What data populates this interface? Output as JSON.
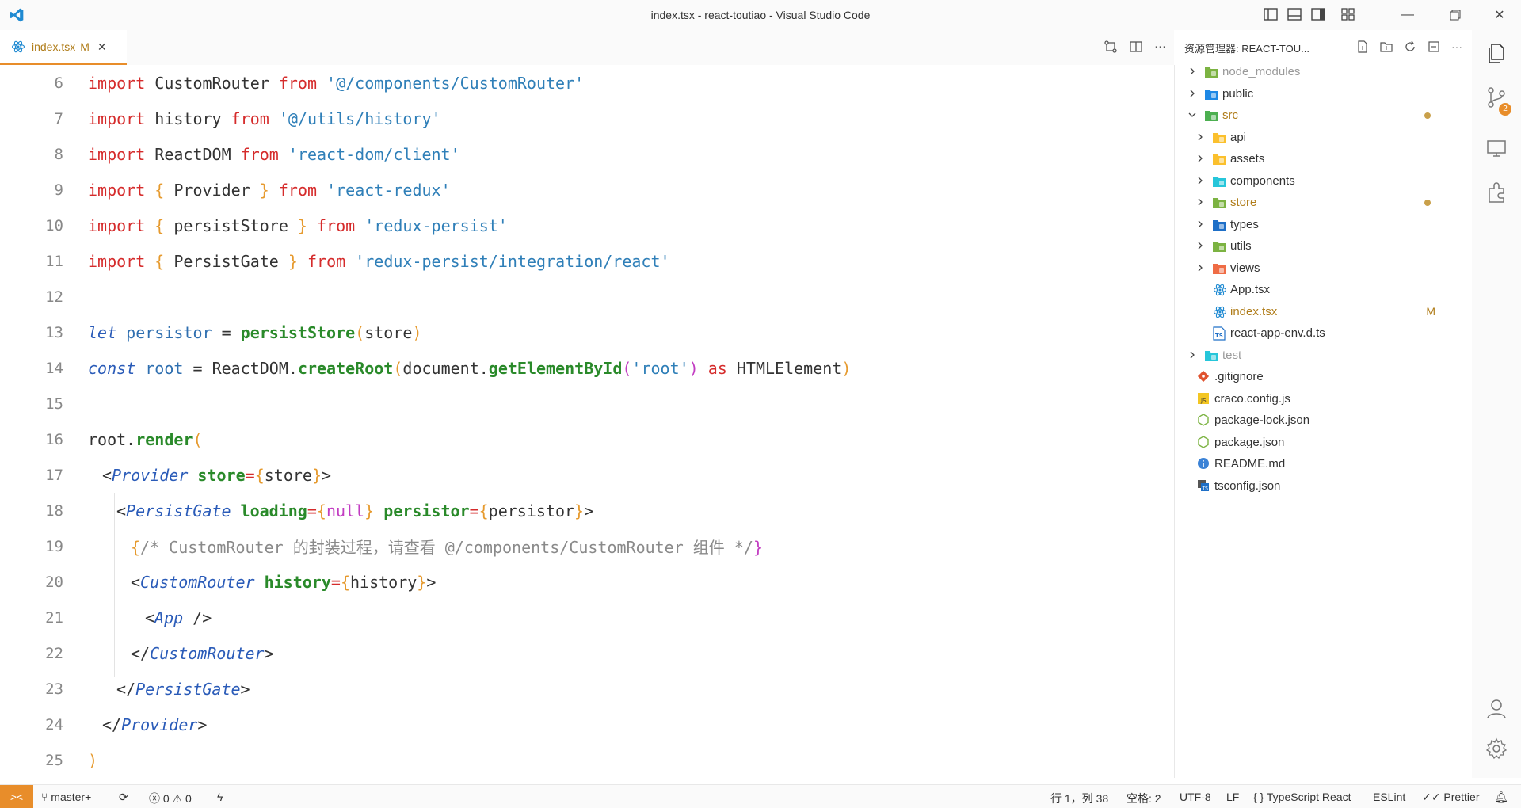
{
  "window": {
    "title": "index.tsx - react-toutiao - Visual Studio Code"
  },
  "tab": {
    "filename": "index.tsx",
    "status": "M"
  },
  "editor": {
    "lines": [
      {
        "n": "6"
      },
      {
        "n": "7"
      },
      {
        "n": "8"
      },
      {
        "n": "9"
      },
      {
        "n": "10"
      },
      {
        "n": "11"
      },
      {
        "n": "12"
      },
      {
        "n": "13"
      },
      {
        "n": "14"
      },
      {
        "n": "15"
      },
      {
        "n": "16"
      },
      {
        "n": "17"
      },
      {
        "n": "18"
      },
      {
        "n": "19"
      },
      {
        "n": "20"
      },
      {
        "n": "21"
      },
      {
        "n": "22"
      },
      {
        "n": "23"
      },
      {
        "n": "24"
      },
      {
        "n": "25"
      }
    ],
    "code": {
      "l6": [
        "import",
        " CustomRouter ",
        "from",
        " ",
        "'@/components/CustomRouter'"
      ],
      "l7": [
        "import",
        " history ",
        "from",
        " ",
        "'@/utils/history'"
      ],
      "l8": [
        "import",
        " ReactDOM ",
        "from",
        " ",
        "'react-dom/client'"
      ],
      "l9": [
        "import",
        " ",
        "{",
        " Provider ",
        "}",
        " ",
        "from",
        " ",
        "'react-redux'"
      ],
      "l10": [
        "import",
        " ",
        "{",
        " persistStore ",
        "}",
        " ",
        "from",
        " ",
        "'redux-persist'"
      ],
      "l11": [
        "import",
        " ",
        "{",
        " PersistGate ",
        "}",
        " ",
        "from",
        " ",
        "'redux-persist/integration/react'"
      ],
      "l13": [
        "let",
        " ",
        "persistor",
        " = ",
        "persistStore",
        "(",
        "store",
        ")"
      ],
      "l14": [
        "const",
        " ",
        "root",
        " = ",
        "ReactDOM",
        ".",
        "createRoot",
        "(",
        "document",
        ".",
        "getElementById",
        "(",
        "'root'",
        ")",
        " ",
        "as",
        " HTMLElement",
        ")"
      ],
      "l16": [
        "root",
        ".",
        "render",
        "("
      ],
      "l17": [
        "<",
        "Provider",
        " ",
        "store",
        "=",
        "{",
        "store",
        "}",
        ">"
      ],
      "l18": [
        "<",
        "PersistGate",
        " ",
        "loading",
        "=",
        "{",
        "null",
        "}",
        " ",
        "persistor",
        "=",
        "{",
        "persistor",
        "}",
        ">"
      ],
      "l19": [
        "{",
        "/* CustomRouter 的封装过程，请查看 @/components/CustomRouter 组件 */",
        "}"
      ],
      "l20": [
        "<",
        "CustomRouter",
        " ",
        "history",
        "=",
        "{",
        "history",
        "}",
        ">"
      ],
      "l21": [
        "<",
        "App",
        " />"
      ],
      "l22": [
        "</",
        "CustomRouter",
        ">"
      ],
      "l23": [
        "</",
        "PersistGate",
        ">"
      ],
      "l24": [
        "</",
        "Provider",
        ">"
      ],
      "l25": [
        ")"
      ]
    }
  },
  "explorer": {
    "title": "资源管理器: REACT-TOU...",
    "items": [
      {
        "label": "node_modules",
        "kind": "folder",
        "color": "#7cb342",
        "depth": 0,
        "collapsed": true,
        "dim": true
      },
      {
        "label": "public",
        "kind": "folder",
        "color": "#1e88e5",
        "depth": 0,
        "collapsed": true
      },
      {
        "label": "src",
        "kind": "folder",
        "color": "#4caf50",
        "depth": 0,
        "collapsed": false,
        "dot": true,
        "modified": true
      },
      {
        "label": "api",
        "kind": "folder",
        "color": "#fbc02d",
        "depth": 1,
        "collapsed": true
      },
      {
        "label": "assets",
        "kind": "folder",
        "color": "#fbc02d",
        "depth": 1,
        "collapsed": true
      },
      {
        "label": "components",
        "kind": "folder",
        "color": "#26c6da",
        "depth": 1,
        "collapsed": true
      },
      {
        "label": "store",
        "kind": "folder",
        "color": "#7cb342",
        "depth": 1,
        "collapsed": true,
        "dot": true,
        "modified": true
      },
      {
        "label": "types",
        "kind": "folder",
        "color": "#1e6fc7",
        "depth": 1,
        "collapsed": true
      },
      {
        "label": "utils",
        "kind": "folder",
        "color": "#7cb342",
        "depth": 1,
        "collapsed": true
      },
      {
        "label": "views",
        "kind": "folder",
        "color": "#ef6c45",
        "depth": 1,
        "collapsed": true
      },
      {
        "label": "App.tsx",
        "kind": "react",
        "depth": 1
      },
      {
        "label": "index.tsx",
        "kind": "react",
        "depth": 1,
        "badge": "M",
        "modified": true
      },
      {
        "label": "react-app-env.d.ts",
        "kind": "ts",
        "depth": 1
      },
      {
        "label": "test",
        "kind": "folder",
        "color": "#26c6da",
        "depth": 0,
        "collapsed": true,
        "dim": true
      },
      {
        "label": ".gitignore",
        "kind": "git",
        "depth": 0
      },
      {
        "label": "craco.config.js",
        "kind": "js",
        "depth": 0
      },
      {
        "label": "package-lock.json",
        "kind": "node",
        "depth": 0
      },
      {
        "label": "package.json",
        "kind": "node",
        "depth": 0
      },
      {
        "label": "README.md",
        "kind": "info",
        "depth": 0
      },
      {
        "label": "tsconfig.json",
        "kind": "tsconfig",
        "depth": 0
      }
    ]
  },
  "activity": {
    "scm_badge": "2"
  },
  "status": {
    "branch": "master+",
    "errors": "0",
    "warnings": "0",
    "position": "行 1，列 38",
    "indent": "空格: 2",
    "encoding": "UTF-8",
    "eol": "LF",
    "language": "TypeScript React",
    "eslint": "ESLint",
    "prettier": "Prettier"
  }
}
